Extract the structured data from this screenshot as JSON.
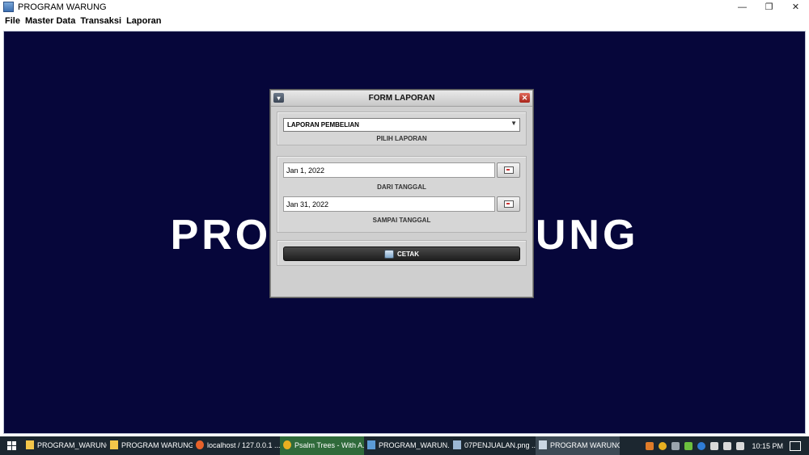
{
  "window": {
    "title": "PROGRAM WARUNG",
    "minimize_glyph": "—",
    "restore_glyph": "❐",
    "close_glyph": "✕"
  },
  "menubar": {
    "items": [
      "File",
      "Master Data",
      "Transaksi",
      "Laporan"
    ]
  },
  "desktop": {
    "background_color": "#06063a",
    "big_title": "PROGRAM WARUNG"
  },
  "dialog": {
    "title": "FORM LAPORAN",
    "report_select": {
      "value": "LAPORAN PEMBELIAN",
      "caption": "PILIH LAPORAN"
    },
    "from_date": {
      "value": "Jan 1, 2022",
      "caption": "DARI TANGGAL"
    },
    "to_date": {
      "value": "Jan 31, 2022",
      "caption": "SAMPAI TANGGAL"
    },
    "print_button": {
      "label": "CETAK",
      "icon": "printer-icon"
    }
  },
  "taskbar": {
    "tasks": [
      {
        "label": "PROGRAM_WARUNG",
        "icon": "folder-icon",
        "color": "#f3c64a"
      },
      {
        "label": "PROGRAM WARUNG",
        "icon": "folder-icon",
        "color": "#f3c64a"
      },
      {
        "label": "localhost / 127.0.0.1 ...",
        "icon": "firefox-icon",
        "color": "#e8622a"
      },
      {
        "label": "Psalm Trees - With A...",
        "icon": "music-icon",
        "color": "#e8b020"
      },
      {
        "label": "PROGRAM_WARUN...",
        "icon": "netbeans-icon",
        "color": "#5b9bd5"
      },
      {
        "label": "07PENJUALAN.png ...",
        "icon": "image-viewer-icon",
        "color": "#9bb7d4"
      },
      {
        "label": "PROGRAM WARUNG",
        "icon": "java-icon",
        "color": "#c9d6e3"
      }
    ],
    "clock": "10:15 PM"
  }
}
